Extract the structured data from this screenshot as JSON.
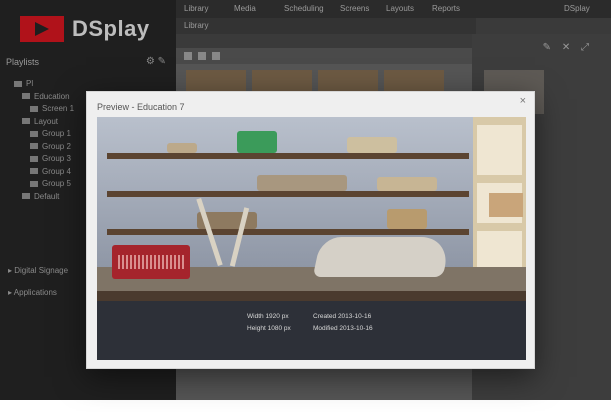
{
  "app": {
    "logo_text": "DSplay",
    "sidebar_header": "Playlists",
    "tree_items": [
      "Pl",
      "Education",
      "Screen 1",
      "Layout",
      "Group 1",
      "Group 2",
      "Group 3",
      "Group 4",
      "Group 5",
      "Default"
    ],
    "sidebar_sections": [
      "Digital Signage",
      "Applications"
    ],
    "menu_items": [
      "Library",
      "Media",
      "Scheduling",
      "Screens",
      "Layouts",
      "Reports"
    ],
    "menu_right": "DSplay",
    "subtab_label": "Library"
  },
  "dialog": {
    "title": "Preview - Education 7",
    "close_label": "×"
  },
  "photo": {
    "description": "",
    "meta": [
      {
        "key": "Width",
        "value": "1920 px"
      },
      {
        "key": "Height",
        "value": "1080 px"
      },
      {
        "key": "Created",
        "value": "2013-10-16"
      },
      {
        "key": "Modified",
        "value": "2013-10-16"
      }
    ]
  },
  "icons": {
    "close": "close-icon",
    "expand": "expand-icon",
    "edit": "edit-icon"
  }
}
